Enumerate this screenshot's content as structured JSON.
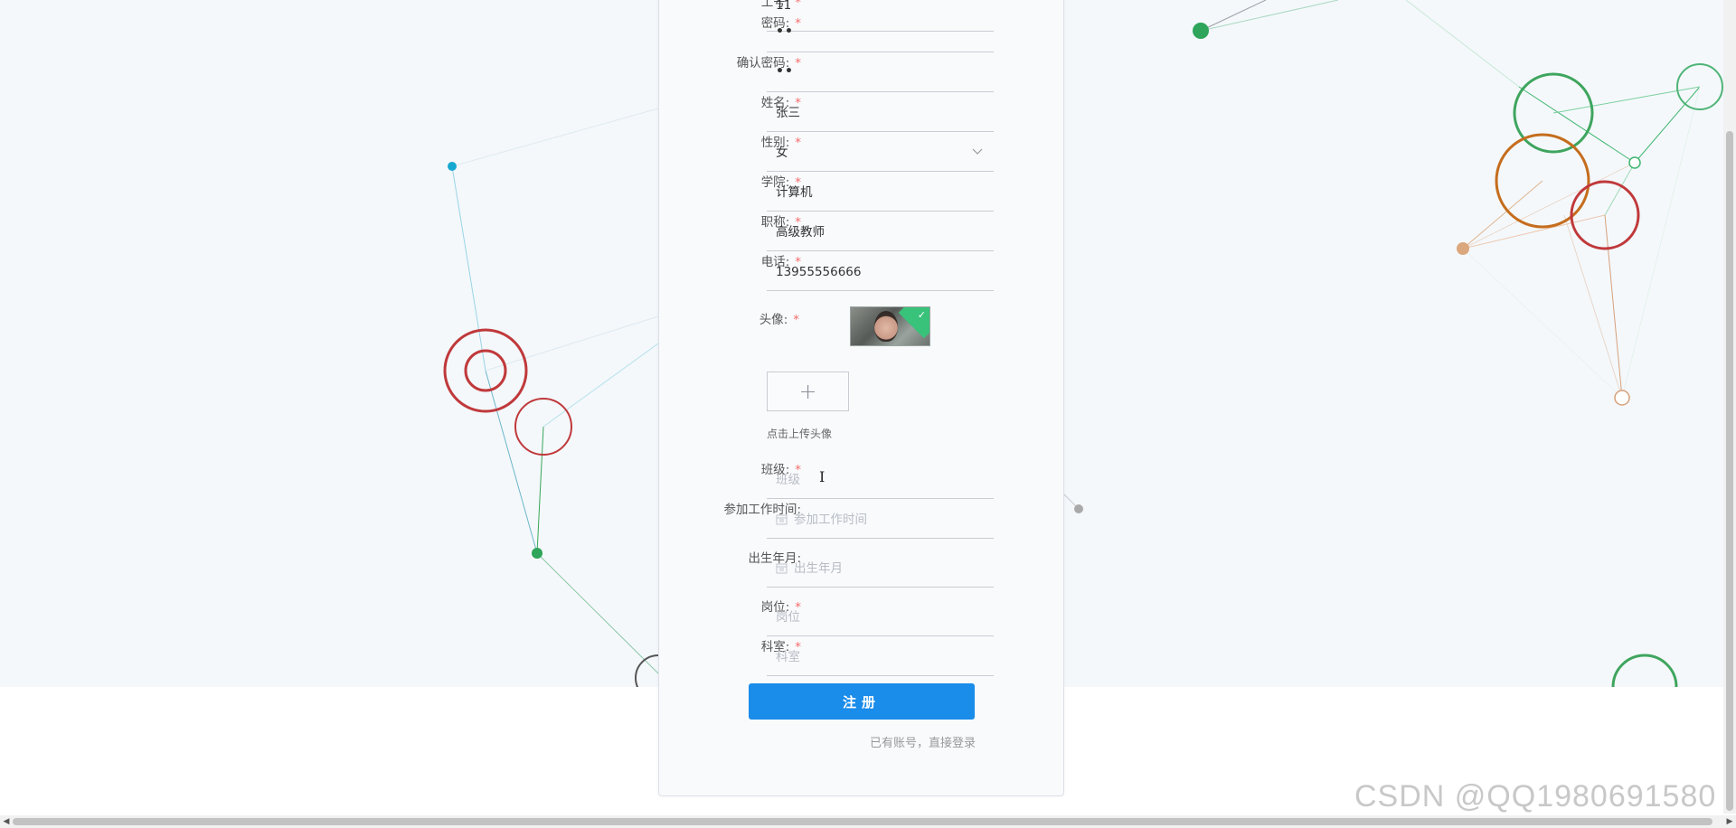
{
  "form": {
    "fields": [
      {
        "label": "工号",
        "value": "11",
        "placeholder": "",
        "required": true,
        "kind": "text"
      },
      {
        "label": "密码",
        "value": "••",
        "placeholder": "",
        "required": true,
        "kind": "password"
      },
      {
        "label": "确认密码",
        "value": "••",
        "placeholder": "",
        "required": true,
        "kind": "password"
      },
      {
        "label": "姓名",
        "value": "张三",
        "placeholder": "",
        "required": true,
        "kind": "text"
      },
      {
        "label": "性别",
        "value": "女",
        "placeholder": "",
        "required": true,
        "kind": "select"
      },
      {
        "label": "学院",
        "value": "计算机",
        "placeholder": "",
        "required": true,
        "kind": "text"
      },
      {
        "label": "职称",
        "value": "高级教师",
        "placeholder": "",
        "required": true,
        "kind": "text"
      },
      {
        "label": "电话",
        "value": "13955556666",
        "placeholder": "",
        "required": true,
        "kind": "text"
      },
      {
        "label": "班级",
        "value": "",
        "placeholder": "班级",
        "required": true,
        "kind": "text"
      },
      {
        "label": "参加工作时间",
        "value": "",
        "placeholder": "参加工作时间",
        "required": false,
        "kind": "date"
      },
      {
        "label": "出生年月",
        "value": "",
        "placeholder": "出生年月",
        "required": false,
        "kind": "date"
      },
      {
        "label": "岗位",
        "value": "",
        "placeholder": "岗位",
        "required": true,
        "kind": "text"
      },
      {
        "label": "科室",
        "value": "",
        "placeholder": "科室",
        "required": true,
        "kind": "text"
      }
    ],
    "avatar": {
      "label": "头像",
      "upload_hint": "点击上传头像",
      "upload_symbol": "+"
    },
    "required_mark": "*",
    "colon": ":",
    "submit_label": "注册",
    "login_link": "已有账号，直接登录"
  },
  "watermark": "CSDN @QQ1980691580",
  "colors": {
    "primary": "#1a8cea",
    "required": "#f56c6c",
    "background": "#f4f8fb"
  },
  "icons": {
    "select": "chevron-down-icon",
    "date": "calendar-icon",
    "upload": "plus-icon",
    "uploaded": "check-icon"
  }
}
